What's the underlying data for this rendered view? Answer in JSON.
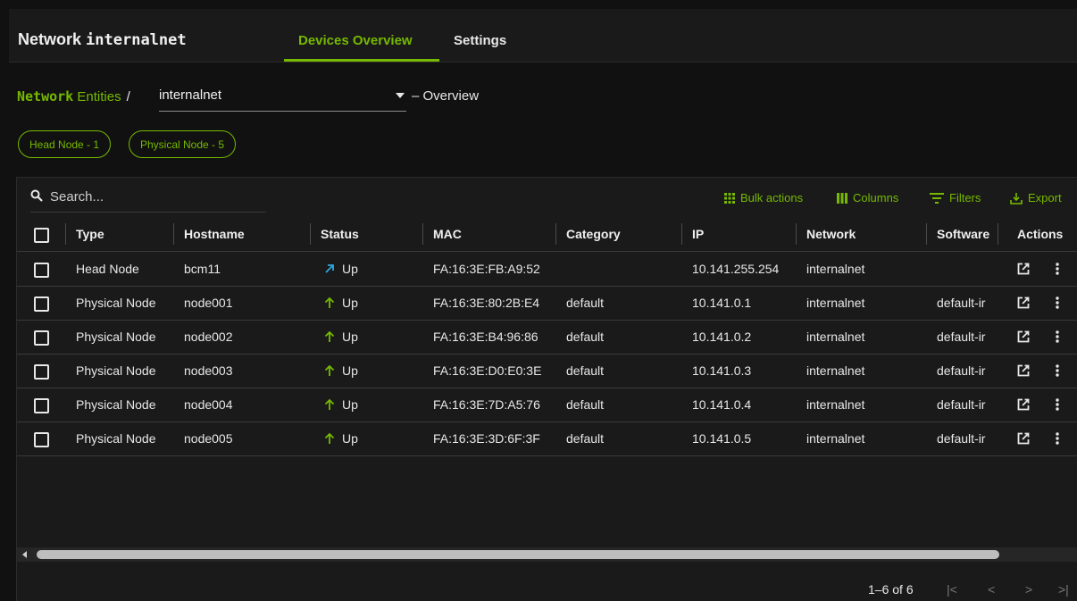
{
  "header": {
    "title_prefix": "Network",
    "title_name": "internalnet",
    "tabs": [
      {
        "label": "Devices Overview",
        "active": true
      },
      {
        "label": "Settings",
        "active": false
      }
    ]
  },
  "breadcrumb": {
    "link_bold": "Network",
    "link_rest": "Entities",
    "separator": "/",
    "selected": "internalnet",
    "suffix": "– Overview"
  },
  "chips": [
    "Head Node - 1",
    "Physical Node - 5"
  ],
  "toolbar": {
    "search_placeholder": "Search...",
    "bulk_actions": "Bulk actions",
    "columns": "Columns",
    "filters": "Filters",
    "export": "Export"
  },
  "table": {
    "headers": [
      "Type",
      "Hostname",
      "Status",
      "MAC",
      "Category",
      "IP",
      "Network",
      "Software",
      "Actions"
    ],
    "rows": [
      {
        "type": "Head Node",
        "hostname": "bcm11",
        "status": "Up",
        "status_icon": "arrow-up-right-icon",
        "mac": "FA:16:3E:FB:A9:52",
        "category": "",
        "ip": "10.141.255.254",
        "network": "internalnet",
        "software": ""
      },
      {
        "type": "Physical Node",
        "hostname": "node001",
        "status": "Up",
        "status_icon": "arrow-up-icon",
        "mac": "FA:16:3E:80:2B:E4",
        "category": "default",
        "ip": "10.141.0.1",
        "network": "internalnet",
        "software": "default-ir"
      },
      {
        "type": "Physical Node",
        "hostname": "node002",
        "status": "Up",
        "status_icon": "arrow-up-icon",
        "mac": "FA:16:3E:B4:96:86",
        "category": "default",
        "ip": "10.141.0.2",
        "network": "internalnet",
        "software": "default-ir"
      },
      {
        "type": "Physical Node",
        "hostname": "node003",
        "status": "Up",
        "status_icon": "arrow-up-icon",
        "mac": "FA:16:3E:D0:E0:3E",
        "category": "default",
        "ip": "10.141.0.3",
        "network": "internalnet",
        "software": "default-ir"
      },
      {
        "type": "Physical Node",
        "hostname": "node004",
        "status": "Up",
        "status_icon": "arrow-up-icon",
        "mac": "FA:16:3E:7D:A5:76",
        "category": "default",
        "ip": "10.141.0.4",
        "network": "internalnet",
        "software": "default-ir"
      },
      {
        "type": "Physical Node",
        "hostname": "node005",
        "status": "Up",
        "status_icon": "arrow-up-icon",
        "mac": "FA:16:3E:3D:6F:3F",
        "category": "default",
        "ip": "10.141.0.5",
        "network": "internalnet",
        "software": "default-ir"
      }
    ]
  },
  "pagination": {
    "range": "1–6 of 6",
    "first": "|<",
    "prev": "<",
    "next": ">",
    "last": ">|"
  },
  "colors": {
    "accent": "#76b900",
    "up_arrow": "#76b900",
    "up_right_arrow": "#2ea8e0",
    "background": "#111111",
    "panel": "#1a1a1a"
  }
}
